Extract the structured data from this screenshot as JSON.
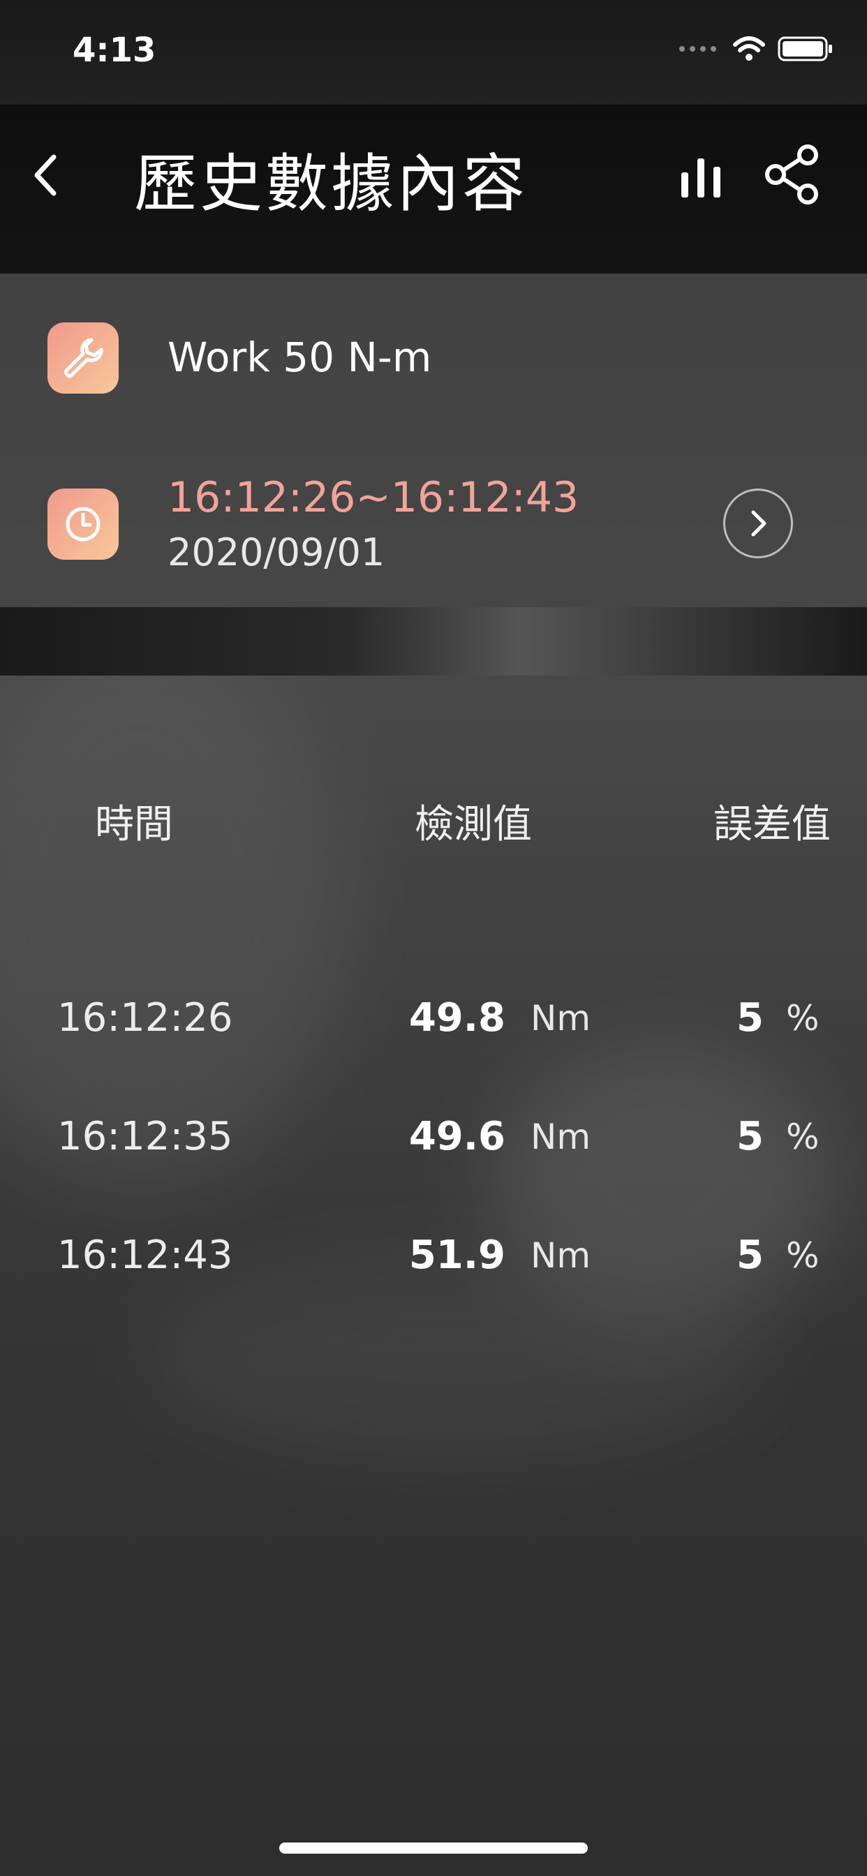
{
  "status_bar": {
    "time": "4:13"
  },
  "nav": {
    "title": "歷史數據內容",
    "back_icon": "chevron-left-icon",
    "chart_icon": "bar-chart-icon",
    "share_icon": "share-icon"
  },
  "info": {
    "tool_name": "Work 50 N-m",
    "tool_icon": "wrench-icon",
    "time_range": "16:12:26~16:12:43",
    "date": "2020/09/01",
    "clock_icon": "clock-icon",
    "next_icon": "chevron-right-icon",
    "accent_color": "#f3a39a"
  },
  "table": {
    "headers": {
      "time": "時間",
      "value": "檢測值",
      "error": "誤差值"
    },
    "rows": [
      {
        "time": "16:12:26",
        "value": "49.8",
        "unit": "Nm",
        "error": "5",
        "error_unit": "%"
      },
      {
        "time": "16:12:35",
        "value": "49.6",
        "unit": "Nm",
        "error": "5",
        "error_unit": "%"
      },
      {
        "time": "16:12:43",
        "value": "51.9",
        "unit": "Nm",
        "error": "5",
        "error_unit": "%"
      }
    ]
  }
}
